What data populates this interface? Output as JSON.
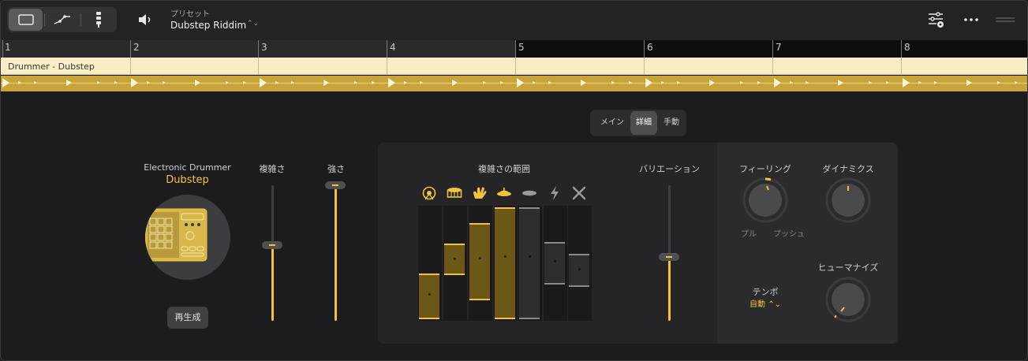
{
  "toolbar": {
    "view_buttons": [
      {
        "icon": "region-view-icon",
        "active": true
      },
      {
        "icon": "automation-curve-icon",
        "active": false
      },
      {
        "icon": "drummer-kit-icon",
        "active": false
      }
    ],
    "speaker_icon": "speaker-icon",
    "preset_label": "プリセット",
    "preset_name": "Dubstep Riddim",
    "preset_chevron": "⌃⌄",
    "right_icons": [
      "mixer-settings-icon",
      "more-icon",
      "drag-handle-icon"
    ]
  },
  "ruler": {
    "bars": [
      "1",
      "2",
      "3",
      "4",
      "5",
      "6",
      "7",
      "8"
    ]
  },
  "region": {
    "title": "Drummer - Dubstep",
    "color": "#c9a43a"
  },
  "modes": {
    "tabs": [
      "メイン",
      "詳細",
      "手動"
    ],
    "active": "詳細"
  },
  "drummer": {
    "label": "Electronic Drummer",
    "name": "Dubstep",
    "regenerate": "再生成"
  },
  "sliders": {
    "complexity": {
      "label": "複雑さ",
      "value": 0.56
    },
    "loudness": {
      "label": "強さ",
      "value": 1.0
    }
  },
  "complexity_range": {
    "label": "複雑さの範囲",
    "instruments": [
      {
        "icon": "kick-drum-icon",
        "active": true
      },
      {
        "icon": "snare-drum-icon",
        "active": true
      },
      {
        "icon": "hand-clap-icon",
        "active": true
      },
      {
        "icon": "hi-hat-icon",
        "active": true
      },
      {
        "icon": "cymbal-icon",
        "active": false
      },
      {
        "icon": "fx-lightning-icon",
        "active": false
      },
      {
        "icon": "percussion-sticks-icon",
        "active": false
      }
    ]
  },
  "variation": {
    "label": "バリエーション",
    "value": 0.47
  },
  "feel": {
    "label": "フィーリング",
    "pull": "プル",
    "push": "プッシュ"
  },
  "dynamics": {
    "label": "ダイナミクス"
  },
  "humanize": {
    "label": "ヒューマナイズ"
  },
  "tempo": {
    "label": "テンポ",
    "value": "自動 ⌃⌄"
  },
  "colors": {
    "accent": "#f2c23b",
    "region": "#c9a43a"
  }
}
